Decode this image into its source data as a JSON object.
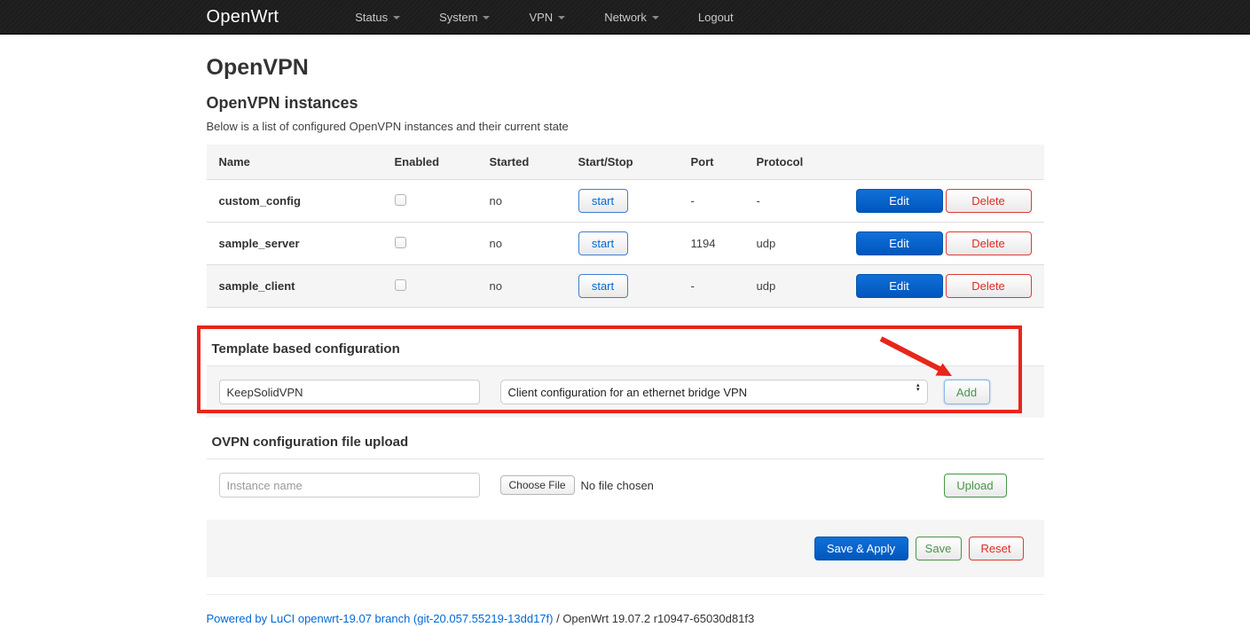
{
  "navbar": {
    "brand": "OpenWrt",
    "items": [
      {
        "label": "Status",
        "dropdown": true
      },
      {
        "label": "System",
        "dropdown": true
      },
      {
        "label": "VPN",
        "dropdown": true
      },
      {
        "label": "Network",
        "dropdown": true
      },
      {
        "label": "Logout",
        "dropdown": false
      }
    ]
  },
  "page": {
    "title": "OpenVPN",
    "instances_heading": "OpenVPN instances",
    "instances_description": "Below is a list of configured OpenVPN instances and their current state"
  },
  "table": {
    "headers": [
      "Name",
      "Enabled",
      "Started",
      "Start/Stop",
      "Port",
      "Protocol"
    ],
    "rows": [
      {
        "name": "custom_config",
        "enabled": false,
        "started": "no",
        "action_label": "start",
        "port": "-",
        "protocol": "-",
        "edit_label": "Edit",
        "delete_label": "Delete"
      },
      {
        "name": "sample_server",
        "enabled": false,
        "started": "no",
        "action_label": "start",
        "port": "1194",
        "protocol": "udp",
        "edit_label": "Edit",
        "delete_label": "Delete"
      },
      {
        "name": "sample_client",
        "enabled": false,
        "started": "no",
        "action_label": "start",
        "port": "-",
        "protocol": "udp",
        "edit_label": "Edit",
        "delete_label": "Delete"
      }
    ]
  },
  "template_section": {
    "heading": "Template based configuration",
    "instance_name_value": "KeepSolidVPN",
    "template_selected_option": "Client configuration for an ethernet bridge VPN",
    "add_label": "Add"
  },
  "upload_section": {
    "heading": "OVPN configuration file upload",
    "instance_name_placeholder": "Instance name",
    "choose_file_label": "Choose File",
    "no_file_text": "No file chosen",
    "upload_label": "Upload"
  },
  "actions": {
    "save_apply_label": "Save & Apply",
    "save_label": "Save",
    "reset_label": "Reset"
  },
  "footer": {
    "link_text": "Powered by LuCI openwrt-19.07 branch (git-20.057.55219-13dd17f)",
    "version_text": " / OpenWrt 19.07.2 r10947-65030d81f3"
  },
  "colors": {
    "navbar_bg": "#1c1c1c",
    "accent_blue": "#0069d6",
    "positive_green": "#479647",
    "negative_red": "#dd2c23",
    "annotation_red": "#e8261a",
    "row_stripe": "#f5f5f5"
  }
}
